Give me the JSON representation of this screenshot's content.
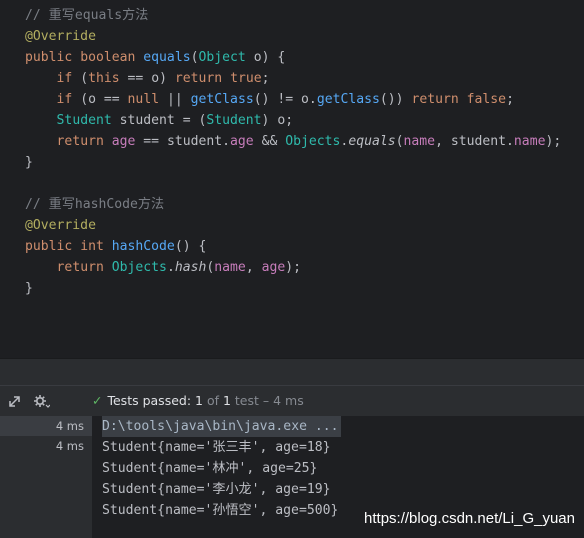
{
  "editor": {
    "comment_equals": "// 重写equals方法",
    "comment_hashcode": "// 重写hashCode方法",
    "annotation": "@Override",
    "kw_public": "public",
    "kw_boolean": "boolean",
    "kw_int": "int",
    "kw_if": "if",
    "kw_this": "this",
    "kw_return": "return",
    "kw_true": "true",
    "kw_false": "false",
    "kw_null": "null",
    "fn_equals": "equals",
    "fn_hashcode": "hashCode",
    "fn_getclass": "getClass",
    "fn_hash": "hash",
    "type_object": "Object",
    "type_student": "Student",
    "type_objects": "Objects",
    "field_age": "age",
    "field_name": "name",
    "var_o": "o",
    "var_student": "student",
    "brace_close": "}"
  },
  "toolbar": {
    "status_prefix": "Tests passed: ",
    "passed_count": "1",
    "of_text": " of ",
    "total_count": "1",
    "test_text": " test",
    "time_text": " – 4 ms"
  },
  "tree": {
    "rows": [
      "4 ms",
      "4 ms"
    ]
  },
  "console": {
    "command": "D:\\tools\\java\\bin\\java.exe ...",
    "lines": [
      "Student{name='张三丰', age=18}",
      "Student{name='林冲', age=25}",
      "Student{name='李小龙', age=19}",
      "Student{name='孙悟空', age=500}"
    ]
  },
  "watermark": "https://blog.csdn.net/Li_G_yuan"
}
